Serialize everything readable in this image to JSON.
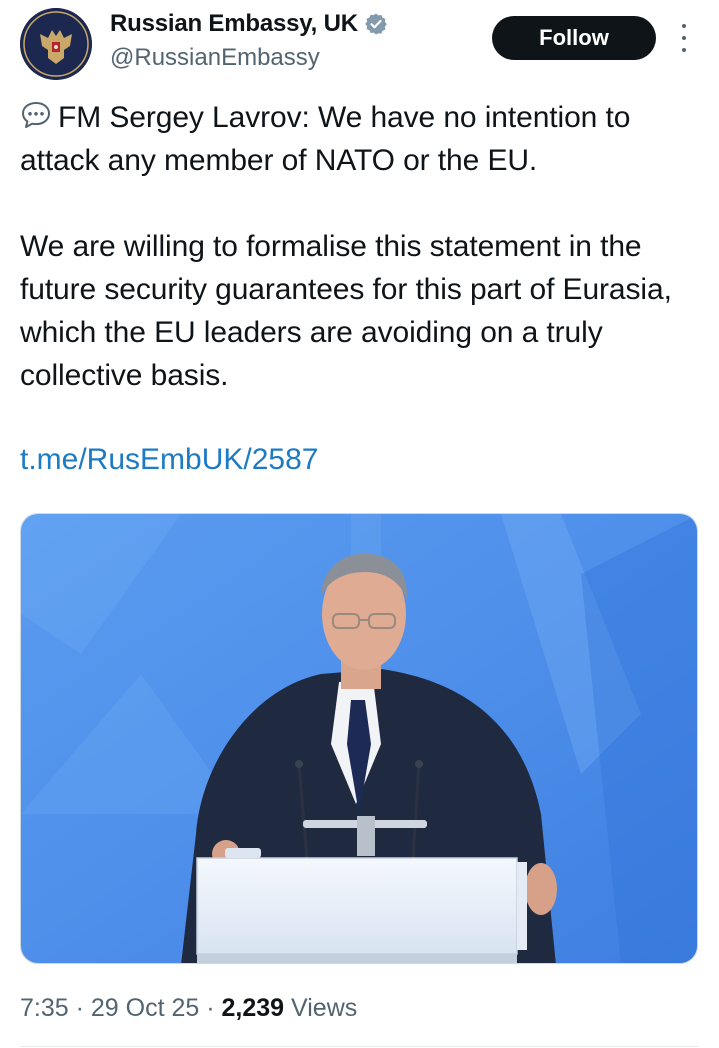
{
  "author": {
    "display_name": "Russian Embassy, UK",
    "handle": "@RussianEmbassy",
    "verified_icon": "verified-badge-icon",
    "avatar_icon": "double-headed-eagle-emblem"
  },
  "actions": {
    "follow_label": "Follow",
    "more_icon": "more-vertical-icon"
  },
  "tweet": {
    "icon": "speech-bubble-icon",
    "line1": "FM Sergey Lavrov: We have no intention to attack any member of NATO or the EU.",
    "line2": "We are willing to formalise this statement in the future security guarantees for this part of Eurasia, which the EU leaders are avoiding on a truly collective basis.",
    "link": "t.me/RusEmbUK/2587"
  },
  "meta": {
    "time": "7:35",
    "sep1": " · ",
    "date": "29 Oct 25",
    "sep2": " · ",
    "views_count": "2,239",
    "views_label": " Views"
  },
  "colors": {
    "link": "#1d7bc4",
    "muted": "#536471",
    "verified": "#829aab",
    "follow_bg": "#0f1419",
    "media_bg": "#4f8fe6"
  }
}
